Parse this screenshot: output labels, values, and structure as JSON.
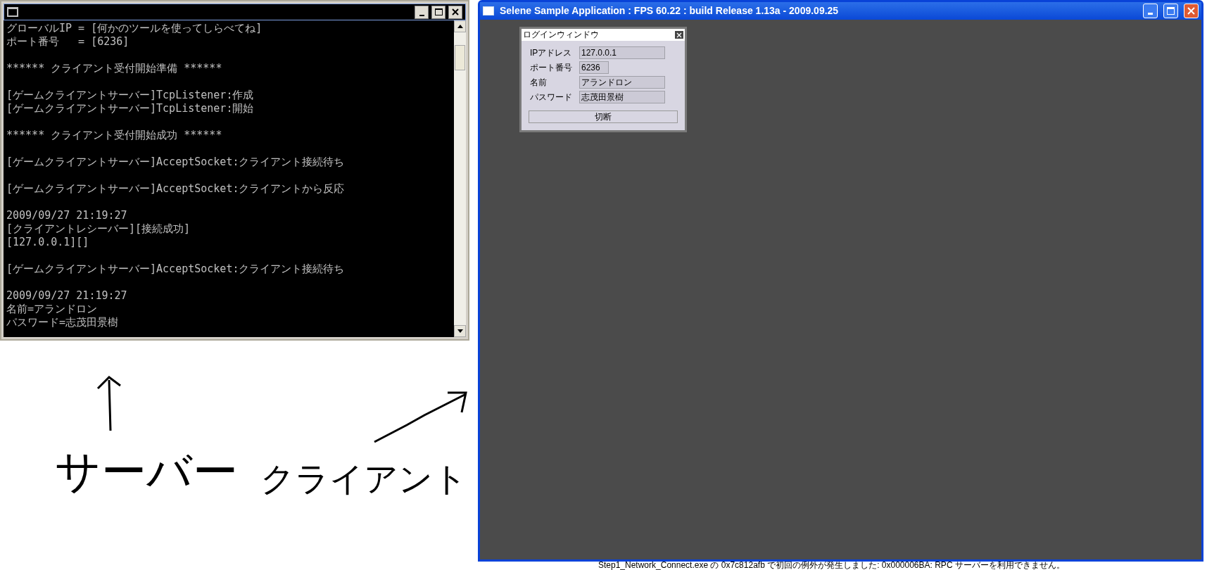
{
  "console": {
    "blocks": [
      [
        "グローバルIP = [何かのツールを使ってしらべてね]",
        "ポート番号   = [6236]"
      ],
      [
        "****** クライアント受付開始準備 ******"
      ],
      [
        "[ゲームクライアントサーバー]TcpListener:作成",
        "[ゲームクライアントサーバー]TcpListener:開始"
      ],
      [
        "****** クライアント受付開始成功 ******"
      ],
      [
        "[ゲームクライアントサーバー]AcceptSocket:クライアント接続待ち"
      ],
      [
        "[ゲームクライアントサーバー]AcceptSocket:クライアントから反応"
      ],
      [
        "2009/09/27 21:19:27",
        "[クライアントレシーバー][接続成功]",
        "[127.0.0.1][]"
      ],
      [
        "[ゲームクライアントサーバー]AcceptSocket:クライアント接続待ち"
      ],
      [
        "2009/09/27 21:19:27",
        "名前=アランドロン",
        "パスワード=志茂田景樹"
      ]
    ]
  },
  "client_window": {
    "title": "Selene Sample Application : FPS 60.22 : build Release 1.13a - 2009.09.25",
    "login_window": {
      "title": "ログインウィンドウ",
      "fields": [
        {
          "label": "IPアドレス",
          "value": "127.0.0.1",
          "kind": "long"
        },
        {
          "label": "ポート番号",
          "value": "6236",
          "kind": "short"
        },
        {
          "label": "名前",
          "value": "アランドロン",
          "kind": "long"
        },
        {
          "label": "パスワード",
          "value": "志茂田景樹",
          "kind": "long"
        }
      ],
      "button": "切断"
    }
  },
  "annotations": {
    "labels": [
      "サーバー",
      "クライアント"
    ]
  },
  "output_line": "Step1_Network_Connect.exe の 0x7c812afb で初回の例外が発生しました: 0x000006BA: RPC サーバーを利用できません。"
}
